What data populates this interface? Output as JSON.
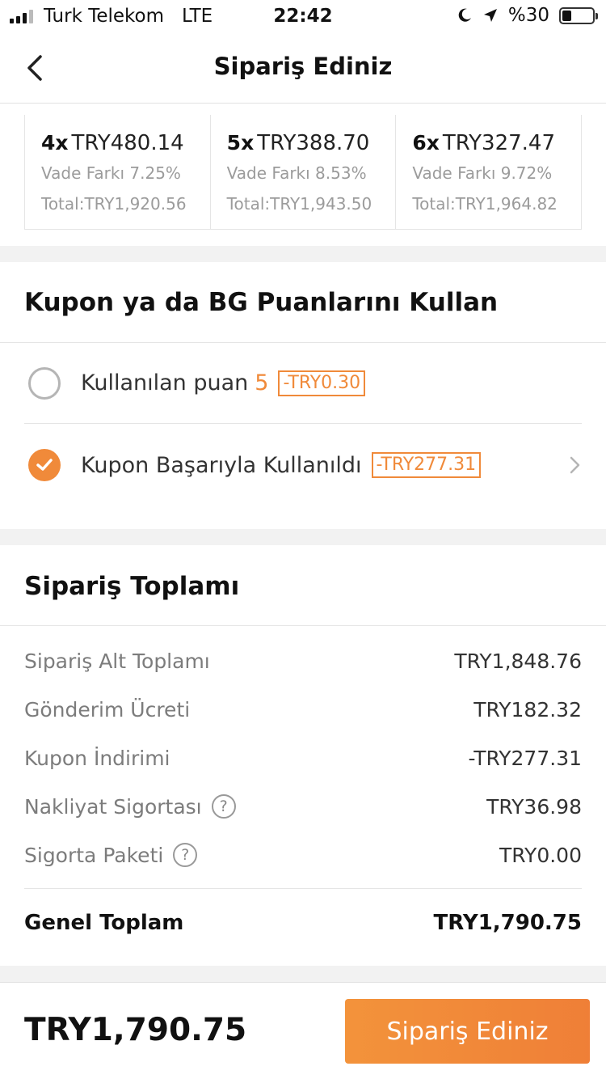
{
  "status_bar": {
    "carrier": "Turk Telekom",
    "network": "LTE",
    "time": "22:42",
    "battery_percent_label": "%30",
    "battery_level": 0.3
  },
  "header": {
    "title": "Sipariş Ediniz",
    "back_icon": "chevron-left-icon"
  },
  "installments": [
    {
      "count": "4x",
      "amount": "TRY480.14",
      "rate": "Vade Farkı 7.25%",
      "total": "Total:TRY1,920.56"
    },
    {
      "count": "5x",
      "amount": "TRY388.70",
      "rate": "Vade Farkı 8.53%",
      "total": "Total:TRY1,943.50"
    },
    {
      "count": "6x",
      "amount": "TRY327.47",
      "rate": "Vade Farkı 9.72%",
      "total": "Total:TRY1,964.82"
    }
  ],
  "coupon": {
    "title": "Kupon ya da BG Puanlarını Kullan",
    "points": {
      "label": "Kullanılan puan",
      "value": "5",
      "discount": "-TRY0.30",
      "selected": false
    },
    "applied": {
      "label": "Kupon Başarıyla Kullanıldı",
      "discount": "-TRY277.31",
      "selected": true
    }
  },
  "order_total": {
    "title": "Sipariş Toplamı",
    "items": [
      {
        "label": "Sipariş Alt Toplamı",
        "value": "TRY1,848.76"
      },
      {
        "label": "Gönderim Ücreti",
        "value": "TRY182.32"
      },
      {
        "label": "Kupon İndirimi",
        "value": "-TRY277.31"
      },
      {
        "label": "Nakliyat Sigortası",
        "value": "TRY36.98",
        "help": "?"
      },
      {
        "label": "Sigorta Paketi",
        "value": "TRY0.00",
        "help": "?"
      }
    ],
    "grand_label": "Genel Toplam",
    "grand_value": "TRY1,790.75"
  },
  "footer": {
    "total": "TRY1,790.75",
    "button_label": "Sipariş Ediniz"
  },
  "colors": {
    "accent": "#f08a3a",
    "muted_text": "#9b9b9b",
    "background": "#f2f2f2"
  }
}
